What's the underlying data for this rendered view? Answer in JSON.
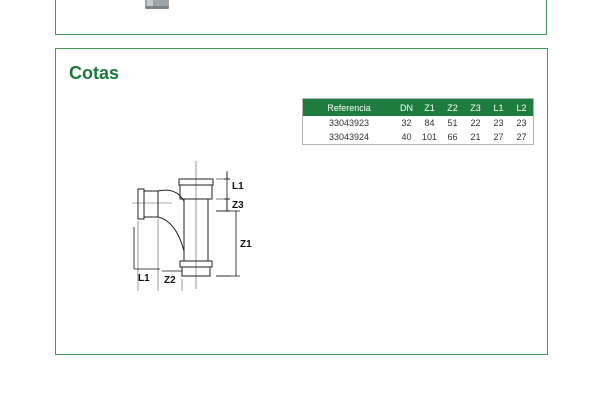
{
  "section": {
    "title": "Cotas"
  },
  "table": {
    "headers": [
      "Referencia",
      "DN",
      "Z1",
      "Z2",
      "Z3",
      "L1",
      "L2"
    ],
    "rows": [
      [
        "33043923",
        "32",
        "84",
        "51",
        "22",
        "23",
        "23"
      ],
      [
        "33043924",
        "40",
        "101",
        "66",
        "21",
        "27",
        "27"
      ]
    ]
  },
  "drawing": {
    "labels": {
      "l1_top": "L1",
      "z3": "Z3",
      "z1": "Z1",
      "l1_bottom": "L1",
      "z2": "Z2"
    }
  },
  "colors": {
    "accent": "#1e7d3e",
    "border": "#3f9a5a",
    "title": "#1b7a3a"
  }
}
